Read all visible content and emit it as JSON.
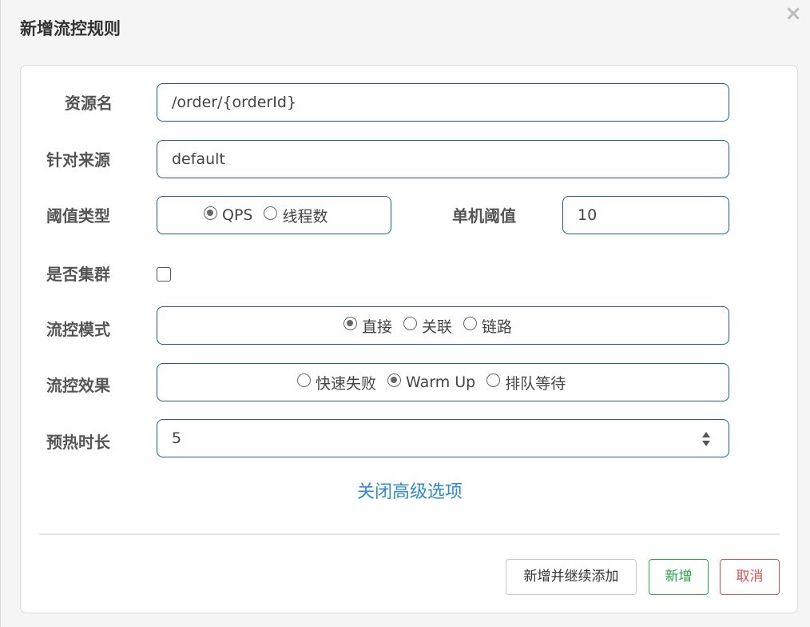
{
  "dialog": {
    "title": "新增流控规则",
    "close_label": "×"
  },
  "form": {
    "resource": {
      "label": "资源名",
      "value": "/order/{orderId}"
    },
    "origin": {
      "label": "针对来源",
      "value": "default"
    },
    "threshold_type": {
      "label": "阈值类型",
      "options": [
        "QPS",
        "线程数"
      ],
      "selected": "QPS"
    },
    "single_threshold": {
      "label": "单机阈值",
      "value": "10"
    },
    "cluster": {
      "label": "是否集群",
      "checked": false
    },
    "flow_mode": {
      "label": "流控模式",
      "options": [
        "直接",
        "关联",
        "链路"
      ],
      "selected": "直接"
    },
    "flow_effect": {
      "label": "流控效果",
      "options": [
        "快速失败",
        "Warm Up",
        "排队等待"
      ],
      "selected": "Warm Up"
    },
    "warmup_period": {
      "label": "预热时长",
      "value": "5"
    },
    "advanced_toggle": "关闭高级选项"
  },
  "footer": {
    "continue_label": "新增并继续添加",
    "add_label": "新增",
    "cancel_label": "取消"
  },
  "colors": {
    "accent_border": "#1f5f8b",
    "link": "#2f8ad0",
    "success": "#28a745",
    "danger": "#d9534f"
  }
}
